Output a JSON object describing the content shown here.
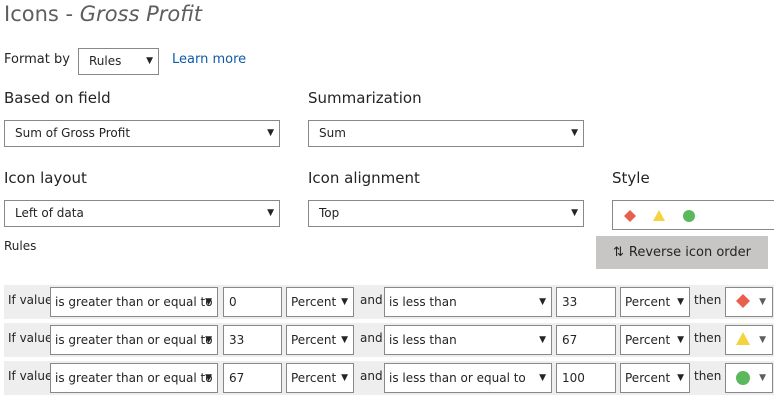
{
  "title": {
    "prefix": "Icons - ",
    "field": "Gross Profit"
  },
  "format_by": {
    "label": "Format by",
    "value": "Rules",
    "learn_more": "Learn more"
  },
  "based_on_field": {
    "label": "Based on field",
    "value": "Sum of Gross Profit"
  },
  "summarization": {
    "label": "Summarization",
    "value": "Sum"
  },
  "icon_layout": {
    "label": "Icon layout",
    "value": "Left of data"
  },
  "icon_alignment": {
    "label": "Icon alignment",
    "value": "Top"
  },
  "style": {
    "label": "Style",
    "icons": [
      "red-diamond",
      "yellow-triangle",
      "green-circle"
    ]
  },
  "rules": {
    "label": "Rules",
    "reverse_button": "Reverse icon order",
    "rows": [
      {
        "if": "If value",
        "op1": "is greater than or equal to",
        "v1": "0",
        "u1": "Percent",
        "and": "and",
        "op2": "is less than",
        "v2": "33",
        "u2": "Percent",
        "then": "then",
        "icon": "red-diamond"
      },
      {
        "if": "If value",
        "op1": "is greater than or equal to",
        "v1": "33",
        "u1": "Percent",
        "and": "and",
        "op2": "is less than",
        "v2": "67",
        "u2": "Percent",
        "then": "then",
        "icon": "yellow-triangle"
      },
      {
        "if": "If value",
        "op1": "is greater than or equal to",
        "v1": "67",
        "u1": "Percent",
        "and": "and",
        "op2": "is less than or equal to",
        "v2": "100",
        "u2": "Percent",
        "then": "then",
        "icon": "green-circle"
      }
    ]
  },
  "colors": {
    "red": "#e8604c",
    "yellow": "#f5d33f",
    "green": "#5bb85d",
    "link": "#0f5aa8",
    "row_bg": "#eeeeee",
    "button_bg": "#c8c6c4"
  }
}
